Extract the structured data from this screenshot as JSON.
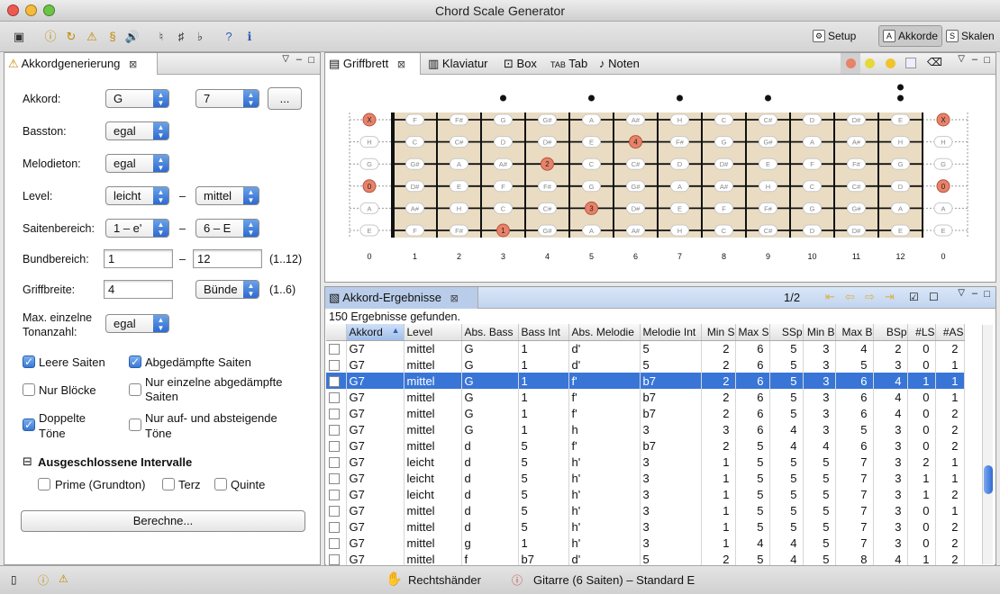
{
  "window": {
    "title": "Chord Scale Generator"
  },
  "toolbar": {
    "icons": [
      "save-icon",
      "info-icon",
      "refresh-icon",
      "warning-icon",
      "scale-icon",
      "volume-icon",
      "natural-icon",
      "sharp-icon",
      "flat-icon",
      "help-icon",
      "tuning-fork-icon"
    ],
    "glyphs": [
      "▣",
      "ⓘ",
      "↻",
      "⚠",
      "§",
      "🔊",
      "♮",
      "♯",
      "♭",
      "?",
      "ℹ"
    ],
    "perspectives": [
      {
        "label": "Setup",
        "icon": "setup-icon",
        "glyph": "⚙"
      },
      {
        "label": "Akkorde",
        "icon": "chords-icon",
        "glyph": "A"
      },
      {
        "label": "Skalen",
        "icon": "scales-icon",
        "glyph": "S"
      }
    ]
  },
  "left_panel": {
    "tab_label": "Akkordgenerierung",
    "akkord_label": "Akkord:",
    "akkord_root": "G",
    "akkord_type": "7",
    "more_button": "...",
    "basston_label": "Basston:",
    "basston_value": "egal",
    "melodieton_label": "Melodieton:",
    "melodieton_value": "egal",
    "level_label": "Level:",
    "level_from": "leicht",
    "level_to": "mittel",
    "dash": "–",
    "saitenbereich_label": "Saitenbereich:",
    "saiten_from": "1 – e'",
    "saiten_to": "6 – E",
    "bundbereich_label": "Bundbereich:",
    "bund_from": "1",
    "bund_to": "12",
    "bund_hint": "(1..12)",
    "griffbreite_label": "Griffbreite:",
    "griffbreite_value": "4",
    "griffbreite_unit": "Bünde",
    "griffbreite_hint": "(1..6)",
    "max_label_1": "Max. einzelne",
    "max_label_2": "Tonanzahl:",
    "max_value": "egal",
    "checks": {
      "leere_saiten": {
        "label": "Leere Saiten",
        "checked": true
      },
      "abgedaempfte": {
        "label": "Abgedämpfte Saiten",
        "checked": true
      },
      "nur_bloecke": {
        "label": "Nur Blöcke",
        "checked": false
      },
      "nur_einzelne_1": "Nur einzelne abgedämpfte",
      "nur_einzelne_2": "Saiten",
      "nur_einzelne_checked": false,
      "doppelte_1": "Doppelte",
      "doppelte_2": "Töne",
      "doppelte_checked": true,
      "aufab_1": "Nur auf- und absteigende",
      "aufab_2": "Töne",
      "aufab_checked": false
    },
    "excluded_title": "Ausgeschlossene Intervalle",
    "collapse_glyph": "⊟",
    "intervals": [
      {
        "label": "Prime (Grundton)",
        "checked": false
      },
      {
        "label": "Terz",
        "checked": false
      },
      {
        "label": "Quinte",
        "checked": false
      }
    ],
    "compute_button": "Berechne..."
  },
  "fretboard_panel": {
    "tabs": [
      {
        "label": "Griffbrett",
        "icon": "fretboard-icon",
        "active": true
      },
      {
        "label": "Klaviatur",
        "icon": "keyboard-icon"
      },
      {
        "label": "Box",
        "icon": "box-icon"
      },
      {
        "label": "Tab",
        "icon": "tab-icon"
      },
      {
        "label": "Noten",
        "icon": "notes-icon"
      }
    ],
    "close_glyph": "⊠",
    "fret_numbers": [
      "0",
      "1",
      "2",
      "3",
      "4",
      "5",
      "6",
      "7",
      "8",
      "9",
      "10",
      "11",
      "12",
      "0"
    ],
    "strings": [
      {
        "open": "E",
        "frets": [
          "F",
          "F#",
          "G",
          "G#",
          "A",
          "A#",
          "H",
          "C",
          "C#",
          "D",
          "D#",
          "E"
        ]
      },
      {
        "open": "H",
        "frets": [
          "C",
          "C#",
          "D",
          "D#",
          "E",
          "F",
          "F#",
          "G",
          "G#",
          "A",
          "A#",
          "H"
        ]
      },
      {
        "open": "G",
        "frets": [
          "G#",
          "A",
          "A#",
          "H",
          "C",
          "C#",
          "D",
          "D#",
          "E",
          "F",
          "F#",
          "G"
        ]
      },
      {
        "open": "D",
        "frets": [
          "D#",
          "E",
          "F",
          "F#",
          "G",
          "G#",
          "A",
          "A#",
          "H",
          "C",
          "C#",
          "D"
        ]
      },
      {
        "open": "A",
        "frets": [
          "A#",
          "H",
          "C",
          "C#",
          "D",
          "D#",
          "E",
          "F",
          "F#",
          "G",
          "G#",
          "A"
        ]
      },
      {
        "open": "E",
        "frets": [
          "F",
          "F#",
          "G",
          "G#",
          "A",
          "A#",
          "H",
          "C",
          "C#",
          "D",
          "D#",
          "E"
        ]
      }
    ],
    "markers": [
      {
        "string": 0,
        "fret": 0,
        "label": "X"
      },
      {
        "string": 1,
        "fret": 6,
        "label": "4"
      },
      {
        "string": 2,
        "fret": 4,
        "label": "2"
      },
      {
        "string": 3,
        "fret": 0,
        "label": "0"
      },
      {
        "string": 4,
        "fret": 5,
        "label": "3"
      },
      {
        "string": 5,
        "fret": 3,
        "label": "1"
      }
    ],
    "inlays": [
      3,
      5,
      7,
      9
    ],
    "double_inlay": 12
  },
  "results_panel": {
    "tab_label": "Akkord-Ergebnisse",
    "page": "1/2",
    "summary": "150 Ergebnisse gefunden.",
    "sort_glyph": "▲",
    "columns": [
      "",
      "Akkord",
      "Level",
      "Abs. Bass",
      "Bass Int",
      "Abs. Melodie",
      "Melodie Int",
      "Min S",
      "Max S",
      "SSp",
      "Min B",
      "Max B",
      "BSp",
      "#LS",
      "#AS"
    ],
    "selected_row": 2,
    "rows": [
      [
        "G7",
        "mittel",
        "G",
        "1",
        "d'",
        "5",
        "2",
        "6",
        "5",
        "3",
        "4",
        "2",
        "0",
        "2"
      ],
      [
        "G7",
        "mittel",
        "G",
        "1",
        "d'",
        "5",
        "2",
        "6",
        "5",
        "3",
        "5",
        "3",
        "0",
        "1"
      ],
      [
        "G7",
        "mittel",
        "G",
        "1",
        "f'",
        "b7",
        "2",
        "6",
        "5",
        "3",
        "6",
        "4",
        "1",
        "1"
      ],
      [
        "G7",
        "mittel",
        "G",
        "1",
        "f'",
        "b7",
        "2",
        "6",
        "5",
        "3",
        "6",
        "4",
        "0",
        "1"
      ],
      [
        "G7",
        "mittel",
        "G",
        "1",
        "f'",
        "b7",
        "2",
        "6",
        "5",
        "3",
        "6",
        "4",
        "0",
        "2"
      ],
      [
        "G7",
        "mittel",
        "G",
        "1",
        "h",
        "3",
        "3",
        "6",
        "4",
        "3",
        "5",
        "3",
        "0",
        "2"
      ],
      [
        "G7",
        "mittel",
        "d",
        "5",
        "f'",
        "b7",
        "2",
        "5",
        "4",
        "4",
        "6",
        "3",
        "0",
        "2"
      ],
      [
        "G7",
        "leicht",
        "d",
        "5",
        "h'",
        "3",
        "1",
        "5",
        "5",
        "5",
        "7",
        "3",
        "2",
        "1"
      ],
      [
        "G7",
        "leicht",
        "d",
        "5",
        "h'",
        "3",
        "1",
        "5",
        "5",
        "5",
        "7",
        "3",
        "1",
        "1"
      ],
      [
        "G7",
        "leicht",
        "d",
        "5",
        "h'",
        "3",
        "1",
        "5",
        "5",
        "5",
        "7",
        "3",
        "1",
        "2"
      ],
      [
        "G7",
        "mittel",
        "d",
        "5",
        "h'",
        "3",
        "1",
        "5",
        "5",
        "5",
        "7",
        "3",
        "0",
        "1"
      ],
      [
        "G7",
        "mittel",
        "d",
        "5",
        "h'",
        "3",
        "1",
        "5",
        "5",
        "5",
        "7",
        "3",
        "0",
        "2"
      ],
      [
        "G7",
        "mittel",
        "g",
        "1",
        "h'",
        "3",
        "1",
        "4",
        "4",
        "5",
        "7",
        "3",
        "0",
        "2"
      ],
      [
        "G7",
        "mittel",
        "f",
        "b7",
        "d'",
        "5",
        "2",
        "5",
        "4",
        "5",
        "8",
        "4",
        "1",
        "2"
      ]
    ]
  },
  "statusbar": {
    "hand": "Rechtshänder",
    "instrument": "Gitarre (6 Saiten) – Standard E"
  },
  "colors": {
    "marker": "#e8826a",
    "selection": "#3875d7",
    "wood": "#e9dcc3"
  }
}
